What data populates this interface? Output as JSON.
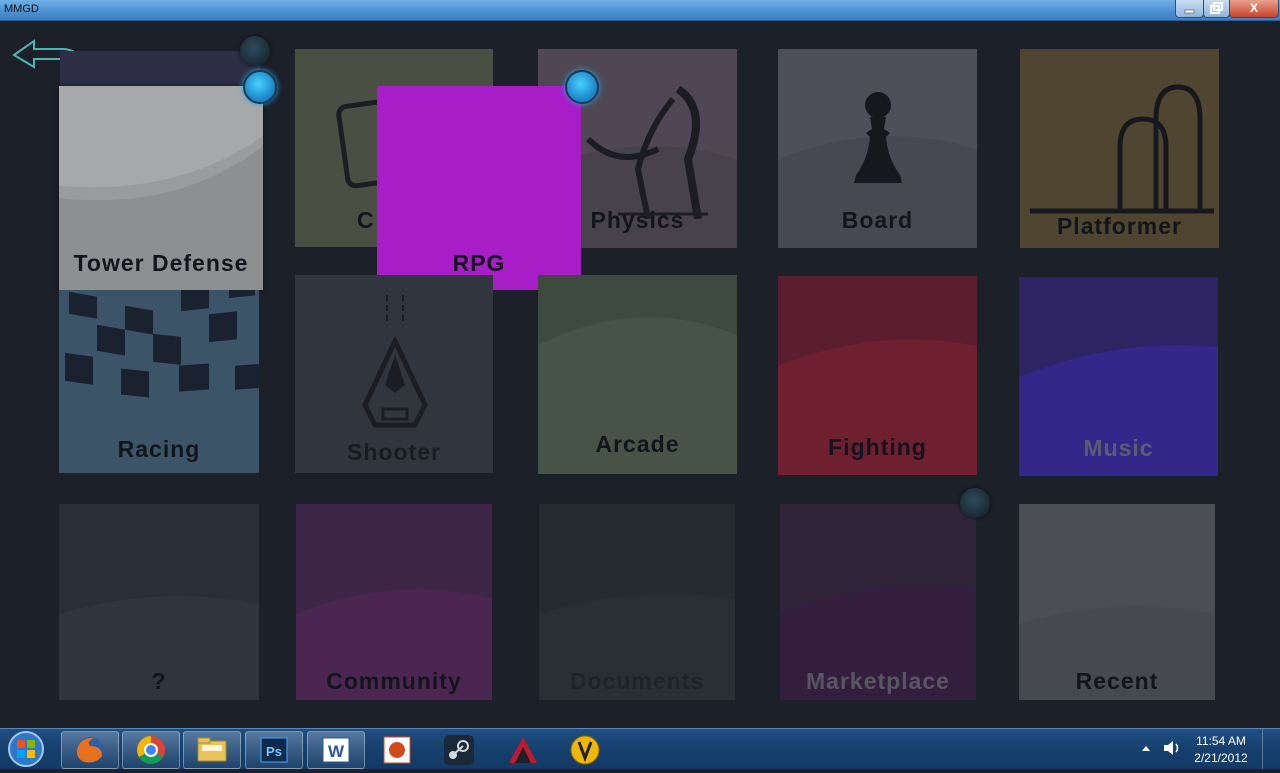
{
  "window": {
    "title": "MMGD",
    "min_label": "",
    "max_label": "",
    "close_label": "X"
  },
  "tiles": {
    "tower_defense": "Tower Defense",
    "card": "C",
    "rpg": "RPG",
    "physics": "Physics",
    "board": "Board",
    "platformer": "Platformer",
    "racing": "Racing",
    "shooter": "Shooter",
    "arcade": "Arcade",
    "fighting": "Fighting",
    "music": "Music",
    "unknown": "?",
    "community": "Community",
    "documents": "Documents",
    "marketplace": "Marketplace",
    "recent": "Recent"
  },
  "colors": {
    "background": "#1b2029",
    "rpg": "#a81dc8",
    "accent_dot": "#2aa7e8"
  },
  "taskbar": {
    "apps": [
      "firefox-icon",
      "chrome-icon",
      "explorer-icon",
      "photoshop-icon",
      "word-icon",
      "powerpoint-icon",
      "steam-icon",
      "autodesk-icon",
      "moviemaker-icon"
    ],
    "photoshop_text": "Ps",
    "word_text": "W",
    "time": "11:54 AM",
    "date": "2/21/2012"
  }
}
